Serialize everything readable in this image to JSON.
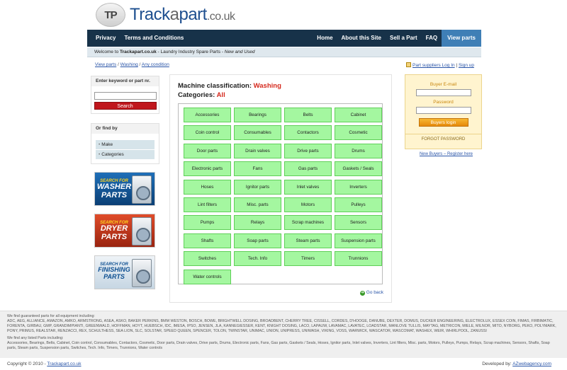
{
  "logo": {
    "badge": "TP",
    "name_main": "Track",
    "name_mid": "a",
    "name_end": "part",
    "suffix": ".co.uk"
  },
  "nav": {
    "left": [
      "Privacy",
      "Terms and Conditions"
    ],
    "right": [
      "Home",
      "About this Site",
      "Sell a Part",
      "FAQ"
    ],
    "active": "View parts"
  },
  "welcome": {
    "prefix": "Welcome to ",
    "site": "Trackapart.co.uk",
    "middle": " - Laundry Industry Spare Parts - ",
    "tail": "New and Used"
  },
  "breadcrumb": {
    "item1": "View parts",
    "sep1": " / ",
    "item2": "Washing",
    "sep2": " / ",
    "item3": "Any condition"
  },
  "toplinks": {
    "suppliers": "Part suppliers Log In",
    "sep": " | ",
    "signup": "Sign up"
  },
  "sidebar": {
    "search_title": "Enter keyword or part nr.",
    "search_value": "",
    "search_button": "Search",
    "find_title": "Or find by",
    "find_items": [
      "Make",
      "Categories"
    ],
    "banners": [
      {
        "line1": "SEARCH FOR",
        "line2": "WASHER",
        "line3": "PARTS"
      },
      {
        "line1": "SEARCH FOR",
        "line2": "DRYER",
        "line3": "PARTS"
      },
      {
        "line1": "SEARCH FOR",
        "line2": "FINISHING",
        "line3": "PARTS"
      }
    ]
  },
  "main": {
    "classification_label": "Machine classification: ",
    "classification_value": "Washing",
    "categories_label": "Categories: ",
    "categories_value": "All",
    "categories": [
      "Accessories",
      "Bearings",
      "Belts",
      "Cabinet",
      "Coin control",
      "Consumables",
      "Contactors",
      "Cosmetic",
      "Door parts",
      "Drain valves",
      "Drive parts",
      "Drums",
      "Electronic parts",
      "Fans",
      "Gas parts",
      "Gaskets / Seals",
      "Hoses",
      "Ignitor parts",
      "Inlet valves",
      "Inverters",
      "Lint filters",
      "Misc. parts",
      "Motors",
      "Pulleys",
      "Pumps",
      "Relays",
      "Scrap machines",
      "Sensors",
      "Shafts",
      "Soap parts",
      "Steam parts",
      "Suspension parts",
      "Switches",
      "Tech. Info",
      "Timers",
      "Trunnions",
      "Water controls"
    ],
    "go_back": "Go back"
  },
  "login": {
    "email_label": "Buyer E-mail",
    "email_value": "",
    "password_label": "Password",
    "password_value": "",
    "button": "Buyers login",
    "forgot": "FORGOT PASSWORD",
    "register": "New Buyers – Register here"
  },
  "footer": {
    "intro": "We find guaranteed parts for all equipment including:",
    "brands": "ADC, AEG, ALLIANCE, AMAZON, AMKO, ARMSTRONG, ASEA, ASKO, BAKER PERKINS, BMM WESTON, BOSCH, BOWE, BRIGHTWELL DOSING, BROADBENT, CHERRY TREE, CISSELL, CORDES, D'HOOGE, DANUBE, DEXTER, DOMUS, DUCKER ENGINEERING, ELECTROLUX, ESSEX COIN, FIMAS, FIRBIMATIC, FORENTA, GIRBAU, GMP, GRANDIMPIANTI, GREENWALD, HOFFMAN, HOYT, HUEBSCH, IDC, IMESA, IPSO, JENSEN, JLA, KANNEGIESSER, KENT, KNIGHT DOSING, LACO, LAPAUW, LAVAMAC, LAVATEC, LOADSTAR, MANLOVE TULLIS, MAYTAG, METRICON, MIELE, MILNOR, MITO, NYBORG, PEKO, POLYMARK, PONY, PRIMUS, REALSTAR, RENZACCI, REX, SCHULTHESS, SEA LION, SLC, SOLSTAR, SPEED QUEEN, SPENCER, TOLON, TWINSTAR, UNIMAC, UNION, UNIPRESS, UNIWASH, VIKING, VOSS, WARWICK, WASCATOR, WASCOMAT, WASHEX, WEIR, WHIRLPOOL, ZANUSSI",
    "types_intro": "We find any listed Parts including:",
    "types": "Accessories, Bearings, Belts, Cabinet, Coin control, Consumables, Contactors, Cosmetic, Door parts, Drain valves, Drive parts, Drums, Electronic parts, Fans, Gas parts, Gaskets / Seals, Hoses, Ignitor parts, Inlet valves, Inverters, Lint filters, Misc. parts, Motors, Pulleys, Pumps, Relays, Scrap machines, Sensors, Shafts, Soap parts, Steam parts, Suspension parts, Switches, Tech. Info, Timers, Trunnions, Water controls",
    "copyright": "Copyright © 2010 - ",
    "copyright_link": "Trackapart.co.uk",
    "developed": "Developed by: ",
    "developed_link": "AZwebagency.com"
  }
}
